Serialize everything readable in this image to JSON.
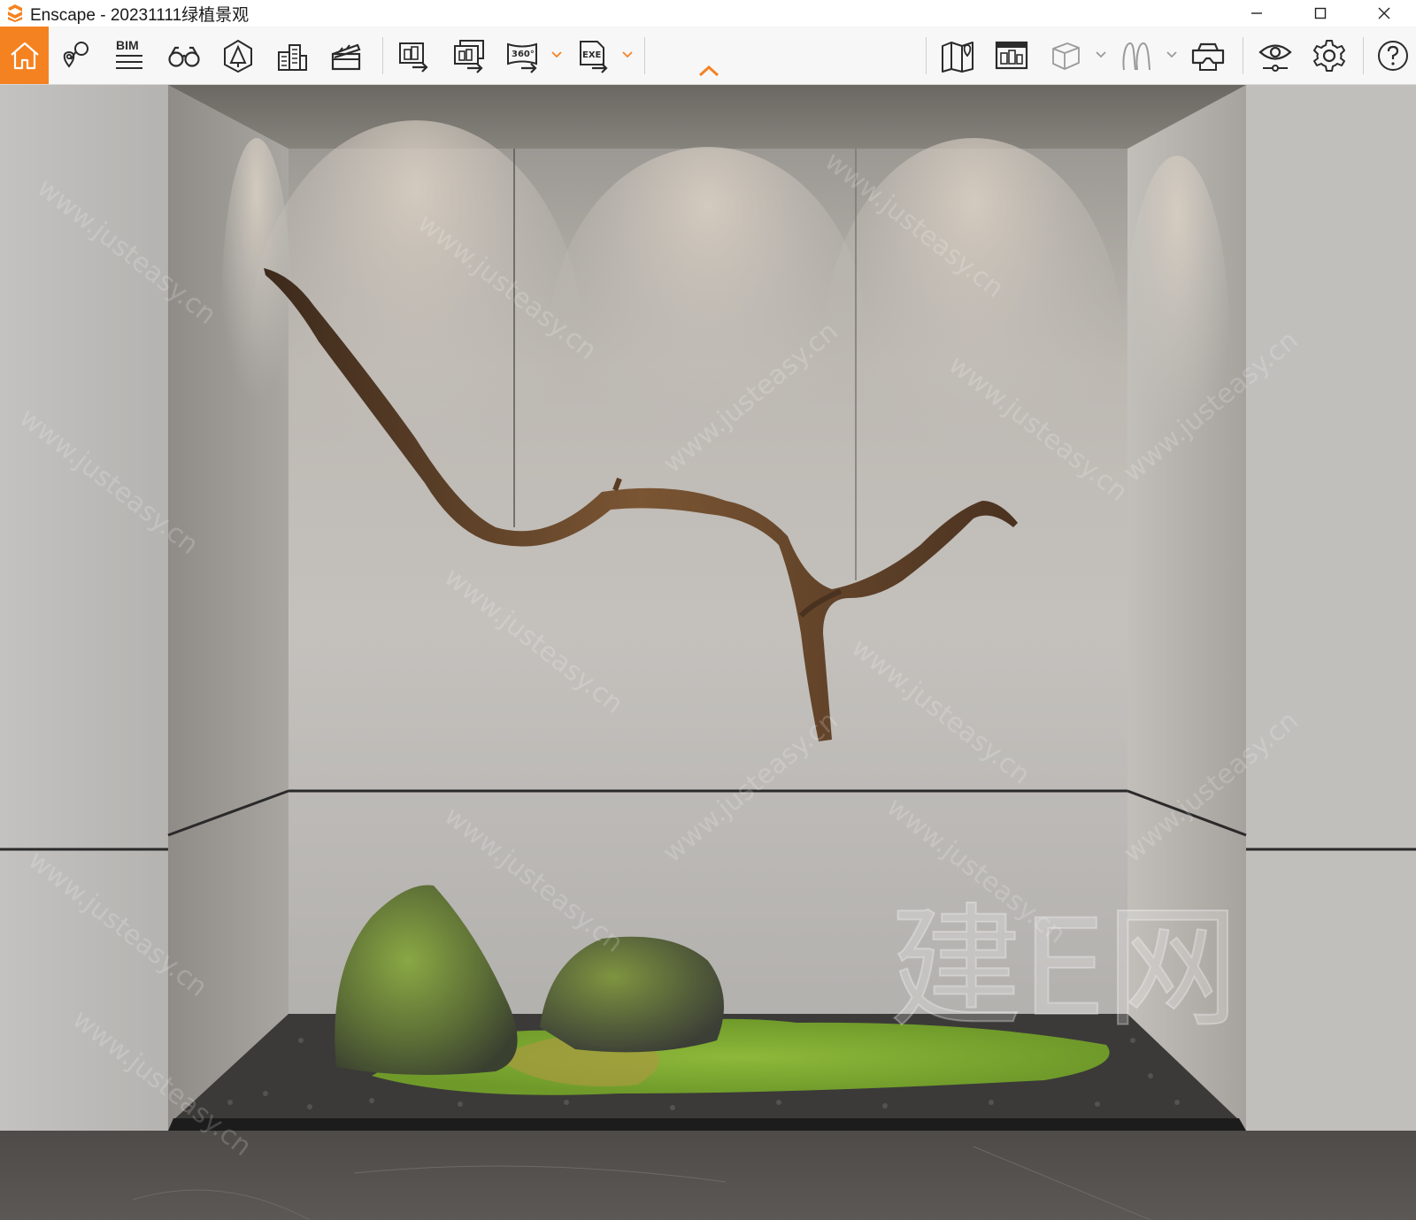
{
  "window": {
    "title": "Enscape - 20231111绿植景观",
    "controls": [
      "minimize-icon",
      "maximize-icon",
      "close-icon"
    ]
  },
  "toolbar": {
    "accent_color": "#f58220",
    "bim_label": "BIM",
    "panorama_label": "360°",
    "exe_label": "EXE",
    "left_group": [
      "home-icon",
      "pin-view-icon",
      "bim-icon",
      "binoculars-icon",
      "asset-library-icon",
      "buildings-icon",
      "clapperboard-icon"
    ],
    "export_group": [
      "screenshot-export-icon",
      "batch-render-icon",
      "panorama-360-icon",
      "exe-export-icon"
    ],
    "right_group": [
      "map-icon",
      "upload-icon",
      "cube-view-icon",
      "walk-mode-icon",
      "vr-headset-icon",
      "visual-settings-icon",
      "settings-gear-icon",
      "help-icon"
    ],
    "collapse_icon": "chevron-up-icon"
  },
  "viewport": {
    "watermark_text": "www.justeasy.cn",
    "watermark_logo": "建E网"
  }
}
